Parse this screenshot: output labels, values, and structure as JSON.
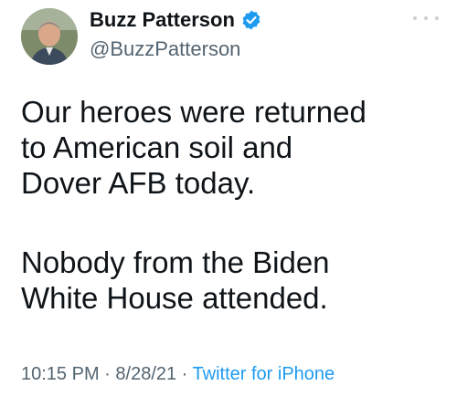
{
  "user": {
    "name": "Buzz Patterson",
    "handle": "@BuzzPatterson",
    "verified": true,
    "avatar_icon": "profile-photo"
  },
  "tweet": {
    "paragraph_1": "Our heroes were returned\nto American soil and\nDover AFB today.",
    "paragraph_2": "Nobody from the Biden\nWhite House attended."
  },
  "meta": {
    "time": "10:15 PM",
    "separator": " · ",
    "date": "8/28/21",
    "source": "Twitter for iPhone"
  },
  "colors": {
    "text": "#0f1419",
    "secondary": "#536471",
    "link": "#1d9bf0",
    "verified": "#1d9bf0"
  }
}
